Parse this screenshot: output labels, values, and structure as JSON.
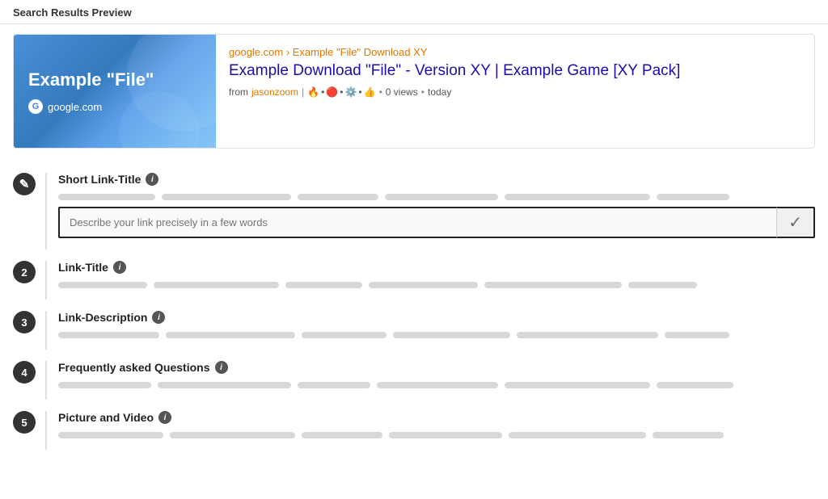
{
  "header": {
    "title": "Search Results Preview"
  },
  "preview": {
    "thumbnail": {
      "title": "Example \"File\"",
      "domain": "google.com"
    },
    "breadcrumb": "google.com › Example \"File\" Download XY",
    "title": "Example Download \"File\" - Version XY | Example Game [XY Pack]",
    "meta": {
      "from_label": "from",
      "author": "jasonzoom",
      "separator": "|",
      "views": "0 views",
      "time": "today"
    }
  },
  "sections": [
    {
      "id": "short-link-title",
      "number": "✎",
      "is_edit": true,
      "label": "Short Link-Title",
      "has_input": true,
      "input_placeholder": "Describe your link precisely in a few words"
    },
    {
      "id": "link-title",
      "number": "2",
      "label": "Link-Title",
      "has_input": false
    },
    {
      "id": "link-description",
      "number": "3",
      "label": "Link-Description",
      "has_input": false
    },
    {
      "id": "faq",
      "number": "4",
      "label": "Frequently asked Questions",
      "has_input": false
    },
    {
      "id": "picture-video",
      "number": "5",
      "label": "Picture and Video",
      "has_input": false
    }
  ],
  "info_icon_label": "i",
  "confirm_button_label": "✓",
  "placeholder_lines": {
    "widths": [
      120,
      160,
      100,
      140,
      180,
      90
    ]
  }
}
